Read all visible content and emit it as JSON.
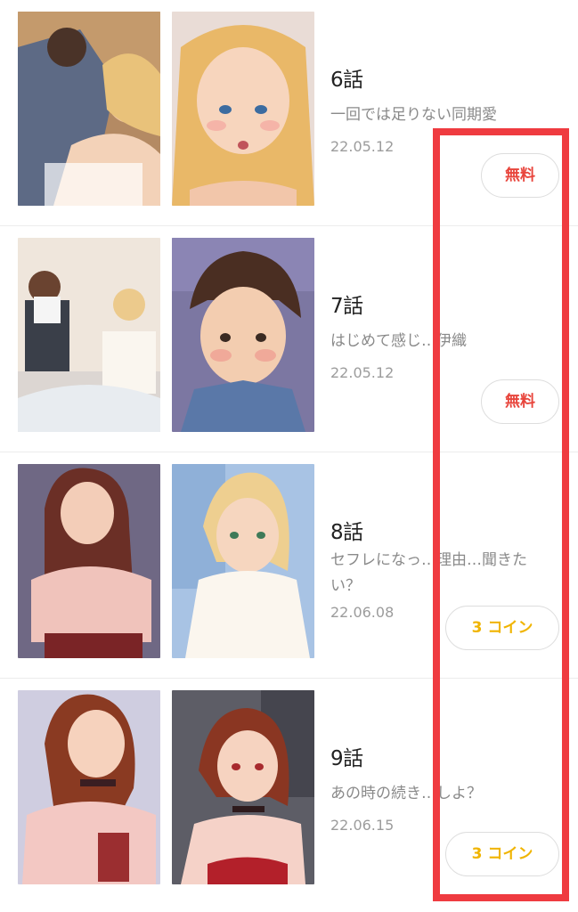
{
  "episodes": [
    {
      "title": "6話",
      "subtitle": "一回では足りない同期愛",
      "date": "22.05.12",
      "price_label": "無料",
      "price_type": "free"
    },
    {
      "title": "7話",
      "subtitle": "はじめて感じ…伊織",
      "date": "22.05.12",
      "price_label": "無料",
      "price_type": "free"
    },
    {
      "title": "8話",
      "subtitle": "セフレになっ…理由…聞きたい？",
      "date": "22.06.08",
      "price_label": "3 コイン",
      "price_type": "coin"
    },
    {
      "title": "9話",
      "subtitle": "あの時の続き…しよ？",
      "date": "22.06.15",
      "price_label": "3 コイン",
      "price_type": "coin"
    }
  ],
  "colors": {
    "free": "#e8453c",
    "coin": "#f0b400",
    "highlight": "#ef3b40"
  },
  "icons": [
    "episode-thumbnail-image"
  ]
}
